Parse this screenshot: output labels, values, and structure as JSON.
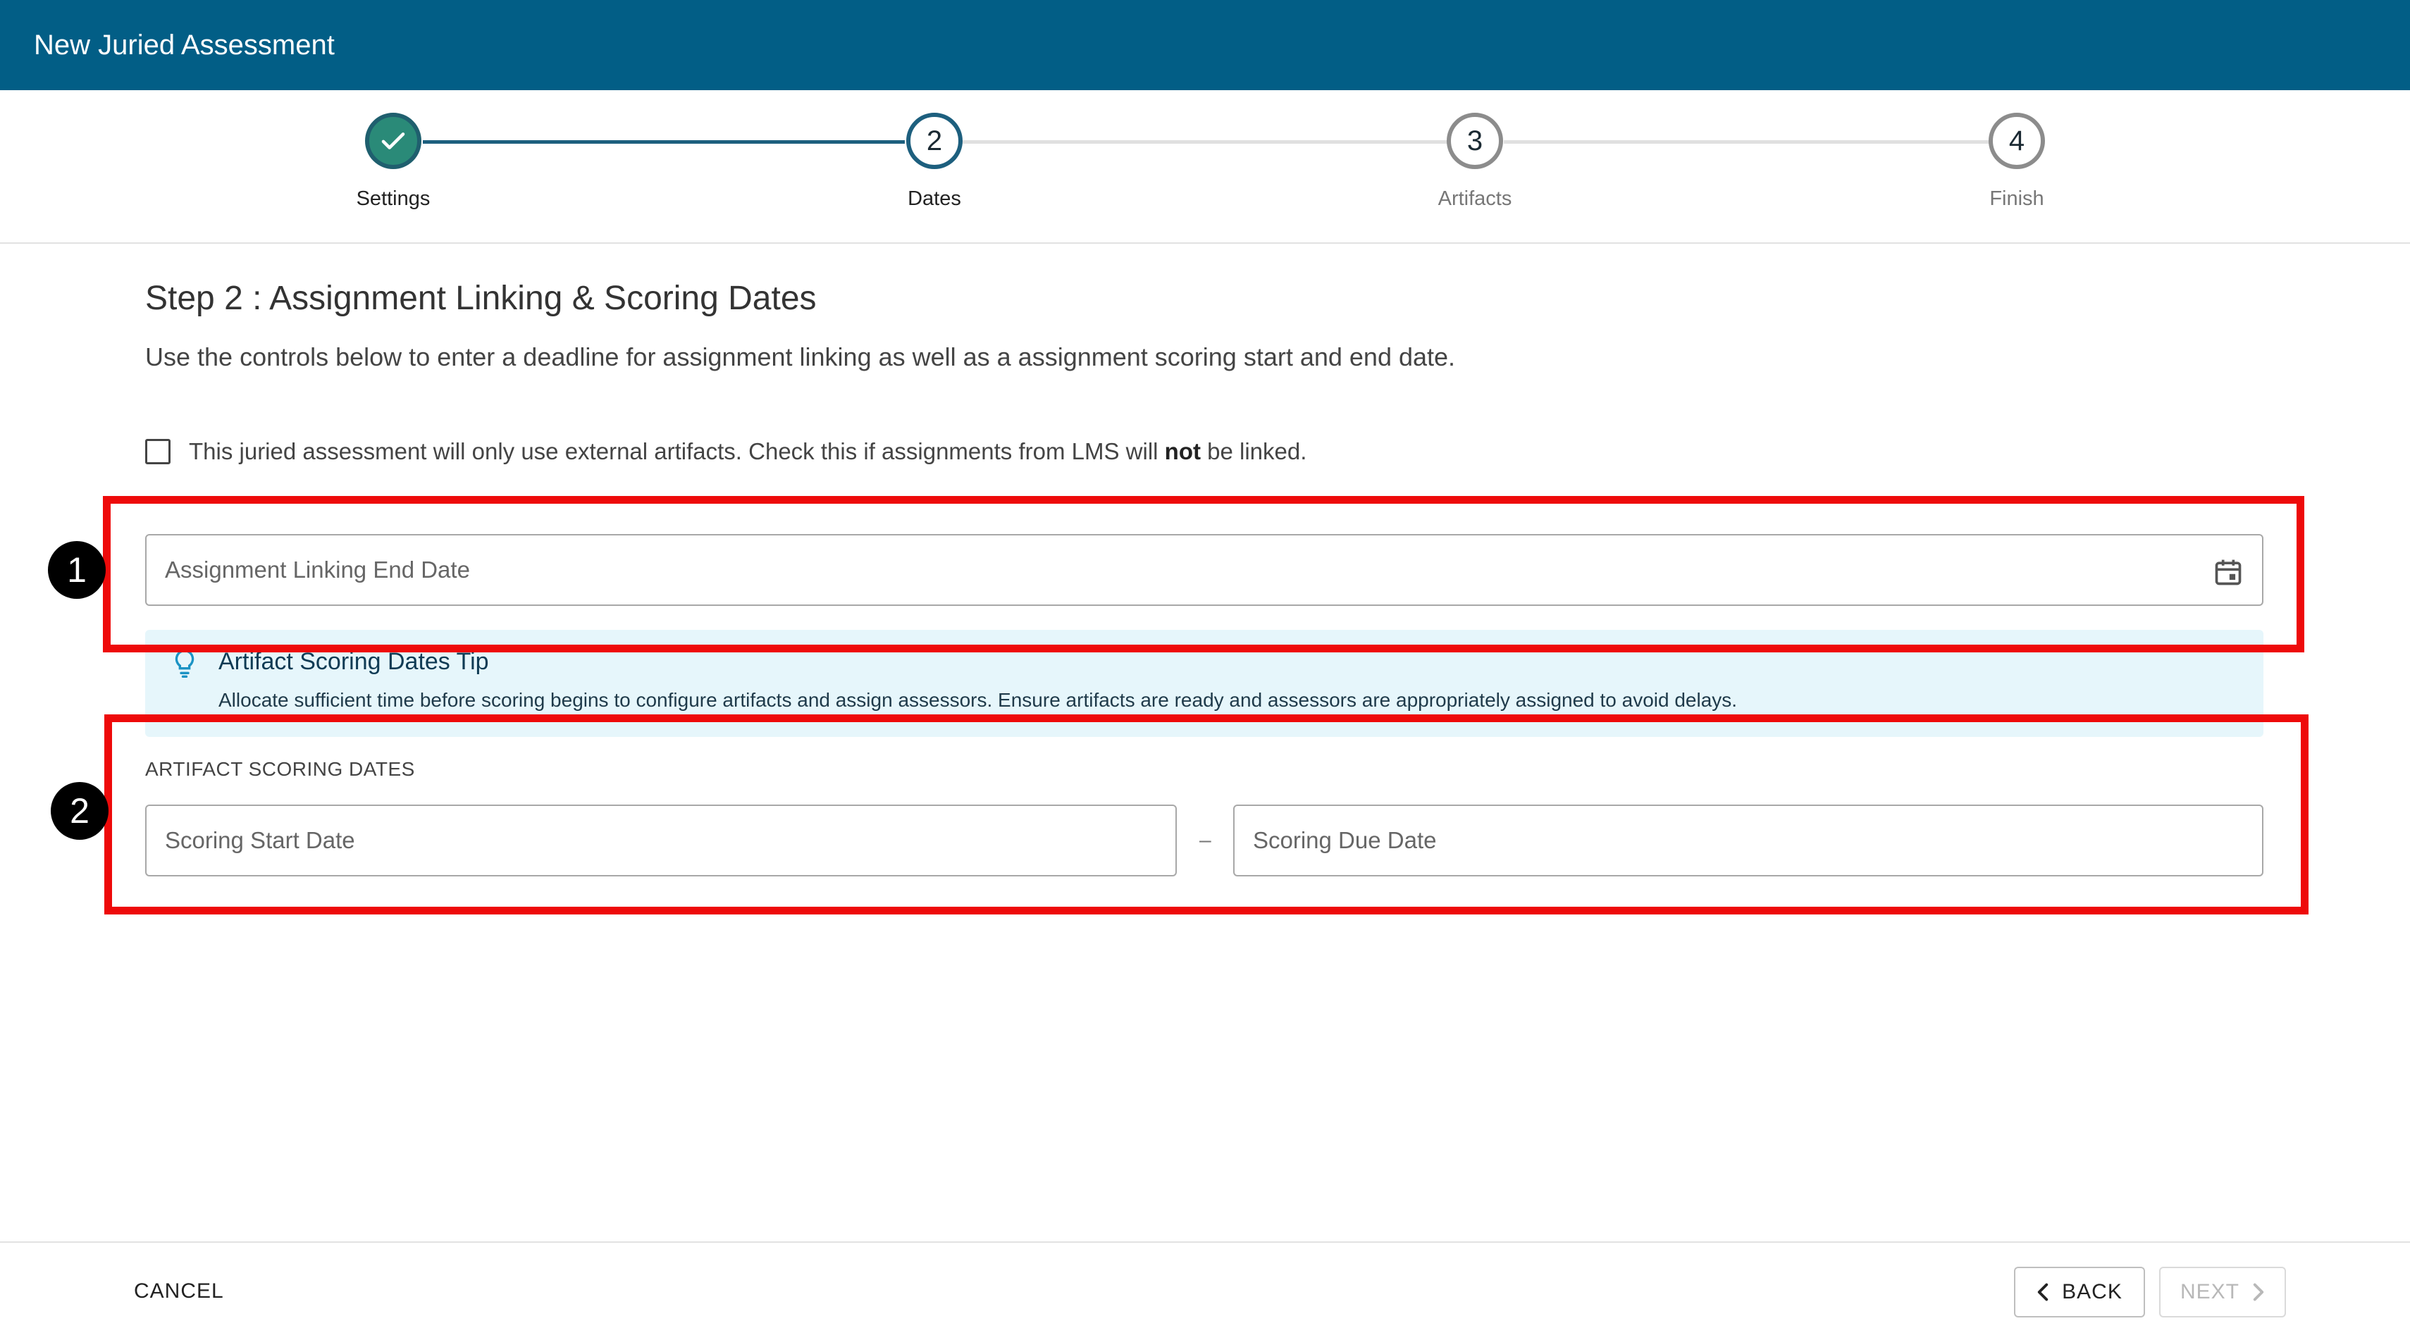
{
  "header": {
    "title": "New Juried Assessment"
  },
  "stepper": {
    "steps": [
      {
        "number": "",
        "label": "Settings",
        "state": "complete"
      },
      {
        "number": "2",
        "label": "Dates",
        "state": "active"
      },
      {
        "number": "3",
        "label": "Artifacts",
        "state": "pending"
      },
      {
        "number": "4",
        "label": "Finish",
        "state": "pending"
      }
    ]
  },
  "main": {
    "title": "Step 2 : Assignment Linking & Scoring Dates",
    "description": "Use the controls below to enter a deadline for assignment linking as well as a assignment scoring start and end date.",
    "external_checkbox": {
      "checked": false,
      "label_before": "This juried assessment will only use external artifacts. Check this if assignments from LMS will ",
      "label_bold": "not",
      "label_after": " be linked."
    },
    "linking_end_date": {
      "placeholder": "Assignment Linking End Date"
    },
    "tip": {
      "title": "Artifact Scoring Dates Tip",
      "text": "Allocate sufficient time before scoring begins to configure artifacts and assign assessors. Ensure artifacts are ready and assessors are appropriately assigned to avoid delays."
    },
    "scoring_dates": {
      "section_label": "ARTIFACT SCORING DATES",
      "start_placeholder": "Scoring Start Date",
      "separator": "–",
      "due_placeholder": "Scoring Due Date"
    }
  },
  "annotations": {
    "marker_1": "1",
    "marker_2": "2",
    "color": "#ee0a0a"
  },
  "footer": {
    "cancel_label": "CANCEL",
    "back_label": "BACK",
    "next_label": "NEXT"
  },
  "colors": {
    "header": "#025e86",
    "step_complete": "#2a8a78",
    "step_active": "#1d5f7e",
    "tip_bg": "#e6f6fb"
  }
}
